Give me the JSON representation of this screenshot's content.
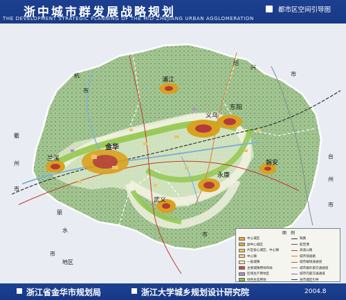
{
  "header": {
    "title": "浙中城市群发展战略规划",
    "subtitle": "THE DEVELOPMENT STRATEGIC PLANNING OF THE MID-ZHEJIANG URBAN AGGLOMERATION",
    "map_name": "都市区空间引导图"
  },
  "map": {
    "places": {
      "jinhua": "金华",
      "yiwu": "义乌",
      "dongyang": "东阳",
      "lanxi": "兰溪",
      "pujiang": "浦江",
      "yongkang": "永康",
      "wuyi": "武义",
      "pan_an": "磐安",
      "hang": "杭",
      "shao": "绍",
      "xing": "兴",
      "shi1": "市",
      "shi2": "市",
      "qu": "衢",
      "zhou": "州",
      "shi3": "市",
      "lishui": "丽",
      "shui": "水",
      "shi4": "市",
      "tai": "台",
      "zhou2": "州",
      "shi5": "市",
      "shi6": "市",
      "area": "地区"
    },
    "colors": {
      "hills": "#9bbf8a",
      "lowland": "#d7e7c4",
      "urban": "#d9a11f",
      "urban_core": "#b23b3b",
      "corridor": "#8dc24a",
      "ring": "#f2f2e8",
      "river": "#7fb1d8",
      "boundary": "#ffffff"
    }
  },
  "legend": {
    "title": "图　例",
    "left_items": [
      {
        "label": "中心城区",
        "color": "#f0a640"
      },
      {
        "label": "副中心城区",
        "color": "#f0a640"
      },
      {
        "label": "片区核心城区、中心镇",
        "color": "#e9c46a"
      },
      {
        "label": "中心镇",
        "color": "#f3d77e"
      },
      {
        "label": "一般城镇",
        "color": "#f8efb4"
      },
      {
        "label": "主要城镇用地布局",
        "color": "#d14848"
      },
      {
        "label": "区域生产用地区",
        "color": "#b98ad0"
      },
      {
        "label": "绿色生态用地",
        "color": "#8dc24a"
      }
    ],
    "right_items": [
      {
        "label": "铁路",
        "color": "#333333"
      },
      {
        "label": "航空港",
        "color": "#555555"
      },
      {
        "label": "高速公路",
        "color": "#c0392b"
      },
      {
        "label": "城市快速路",
        "color": "#e07b39"
      },
      {
        "label": "城市群快速通道",
        "color": "#d35400"
      },
      {
        "label": "城市群外部交通通道",
        "color": "#7f8c8d"
      },
      {
        "label": "城市内部交通通道",
        "color": "#9b59b6"
      },
      {
        "label": "县市城区引导",
        "color": "#2c3e50"
      }
    ]
  },
  "footer": {
    "left": "浙江省金华市规划局",
    "mid": "浙江大学城乡规划设计研究院",
    "date": "2004.8"
  }
}
